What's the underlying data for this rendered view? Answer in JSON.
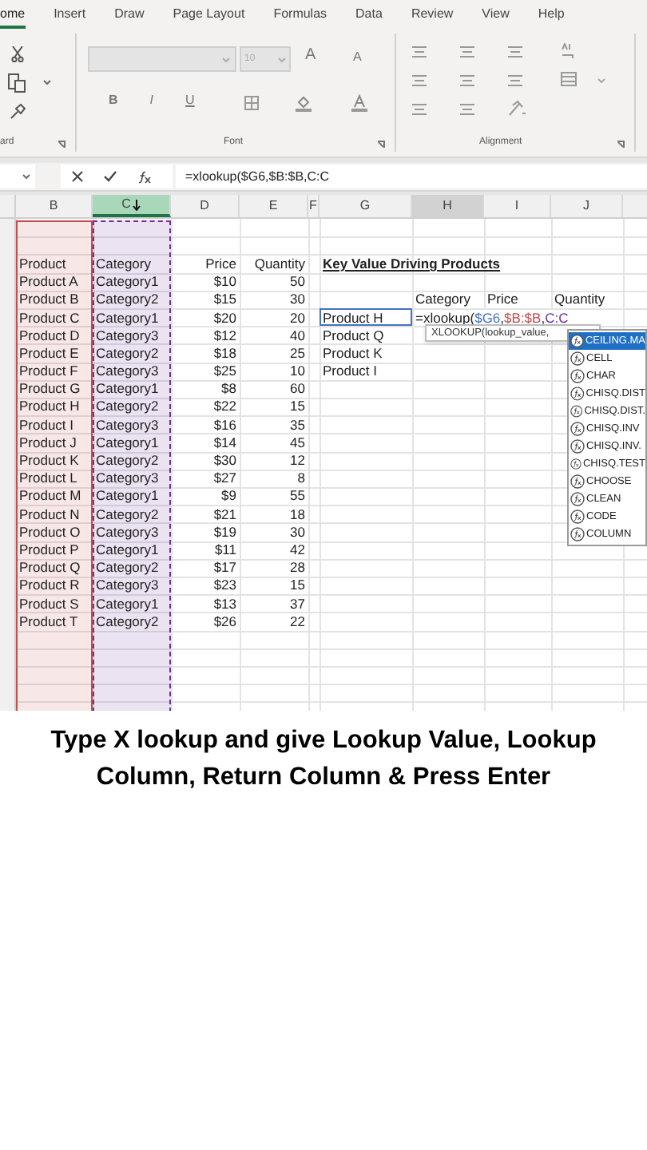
{
  "ribbon_tabs": [
    {
      "label": "ome",
      "selected": true
    },
    {
      "label": "Insert",
      "selected": false
    },
    {
      "label": "Draw",
      "selected": false
    },
    {
      "label": "Page Layout",
      "selected": false
    },
    {
      "label": "Formulas",
      "selected": false
    },
    {
      "label": "Data",
      "selected": false
    },
    {
      "label": "Review",
      "selected": false
    },
    {
      "label": "View",
      "selected": false
    },
    {
      "label": "Help",
      "selected": false
    }
  ],
  "ribbon_groups": [
    {
      "label": "ard"
    },
    {
      "label": "Font"
    },
    {
      "label": "Alignment"
    }
  ],
  "font_group": {
    "font_name_disabled": true,
    "font_size": "10",
    "grow_label": "A",
    "shrink_label": "A",
    "format_buttons": [
      "B",
      "I",
      "U"
    ]
  },
  "formula_bar": {
    "formula": "=xlookup($G6,$B:$B,C:C"
  },
  "sheet": {
    "columns": [
      {
        "label": "B",
        "selected": false,
        "active": false,
        "color": "#c0504d"
      },
      {
        "label": "C",
        "selected": true,
        "active": false,
        "color": "#7030a0"
      },
      {
        "label": "D",
        "selected": false,
        "active": false
      },
      {
        "label": "E",
        "selected": false,
        "active": false
      },
      {
        "label": "F",
        "selected": false,
        "active": false
      },
      {
        "label": "G",
        "selected": false,
        "active": false
      },
      {
        "label": "H",
        "selected": false,
        "active": true
      },
      {
        "label": "I",
        "selected": false,
        "active": false
      },
      {
        "label": "J",
        "selected": false,
        "active": false
      }
    ],
    "rows": [
      [
        "Product",
        "Category",
        "Price",
        "Quantity",
        "",
        {
          "text": "Key Value Driving Products",
          "kind": "heading"
        }
      ],
      [
        "Product A",
        "Category1",
        "$10",
        "50"
      ],
      [
        "Product B",
        "Category2",
        "$15",
        "30",
        "",
        "",
        "Category",
        "Price",
        "Quantity"
      ],
      [
        "Product C",
        "Category1",
        "$20",
        "20",
        "",
        {
          "text": "Product H",
          "kind": "reference",
          "color": "#4472c4"
        },
        {
          "kind": "formula",
          "parts": [
            {
              "text": "=xlookup("
            },
            {
              "text": "$G6",
              "color": "#4472c4"
            },
            {
              "text": ","
            },
            {
              "text": "$B:$B",
              "color": "#c0504d"
            },
            {
              "text": ","
            },
            {
              "text": "C:C",
              "color": "#7030a0"
            }
          ]
        }
      ],
      [
        "Product D",
        "Category3",
        "$12",
        "40",
        "",
        "Product Q"
      ],
      [
        "Product E",
        "Category2",
        "$18",
        "25",
        "",
        "Product K"
      ],
      [
        "Product F",
        "Category3",
        "$25",
        "10",
        "",
        "Product I"
      ],
      [
        "Product G",
        "Category1",
        "$8",
        "60"
      ],
      [
        "Product H",
        "Category2",
        "$22",
        "15"
      ],
      [
        "Product I",
        "Category3",
        "$16",
        "35"
      ],
      [
        "Product J",
        "Category1",
        "$14",
        "45"
      ],
      [
        "Product K",
        "Category2",
        "$30",
        "12"
      ],
      [
        "Product L",
        "Category3",
        "$27",
        "8"
      ],
      [
        "Product M",
        "Category1",
        "$9",
        "55"
      ],
      [
        "Product N",
        "Category2",
        "$21",
        "18"
      ],
      [
        "Product O",
        "Category3",
        "$19",
        "30"
      ],
      [
        "Product P",
        "Category1",
        "$11",
        "42"
      ],
      [
        "Product Q",
        "Category2",
        "$17",
        "28"
      ],
      [
        "Product R",
        "Category3",
        "$23",
        "15"
      ],
      [
        "Product S",
        "Category1",
        "$13",
        "37"
      ],
      [
        "Product T",
        "Category2",
        "$26",
        "22"
      ]
    ]
  },
  "function_tooltip": "XLOOKUP(lookup_value,",
  "autocomplete": [
    {
      "label": "CEILING.MA",
      "selected": true
    },
    {
      "label": "CELL",
      "selected": false
    },
    {
      "label": "CHAR",
      "selected": false
    },
    {
      "label": "CHISQ.DIST",
      "selected": false
    },
    {
      "label": "CHISQ.DIST.",
      "selected": false
    },
    {
      "label": "CHISQ.INV",
      "selected": false
    },
    {
      "label": "CHISQ.INV.",
      "selected": false
    },
    {
      "label": "CHISQ.TEST",
      "selected": false
    },
    {
      "label": "CHOOSE",
      "selected": false
    },
    {
      "label": "CLEAN",
      "selected": false
    },
    {
      "label": "CODE",
      "selected": false
    },
    {
      "label": "COLUMN",
      "selected": false
    }
  ],
  "caption": "Type X lookup and give Lookup Value, Lookup Column, Return Column & Press Enter"
}
